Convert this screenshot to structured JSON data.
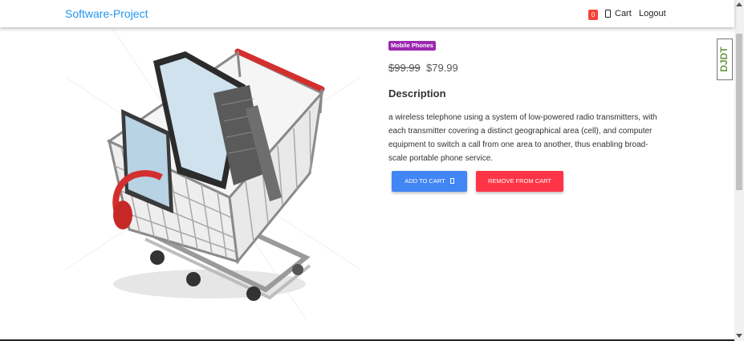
{
  "navbar": {
    "brand": "Software-Project",
    "cart_count": "0",
    "cart_label": "Cart",
    "logout_label": "Logout"
  },
  "product": {
    "category": "Mobile Phones",
    "old_price": "$99.99",
    "new_price": "$79.99",
    "description_heading": "Description",
    "description": "a wireless telephone using a system of low-powered radio transmitters, with each transmitter covering a distinct geographical area (cell), and computer equipment to switch a call from one area to another, thus enabling broad-scale portable phone service.",
    "add_to_cart_label": "ADD TO CART",
    "remove_from_cart_label": "REMOVE FROM CART"
  },
  "side_logo_text": "DJDT",
  "colors": {
    "brand": "#2196f3",
    "category_badge": "#9c27b0",
    "add_button": "#4285f4",
    "remove_button": "#ff3547",
    "cart_badge": "#f44336"
  }
}
